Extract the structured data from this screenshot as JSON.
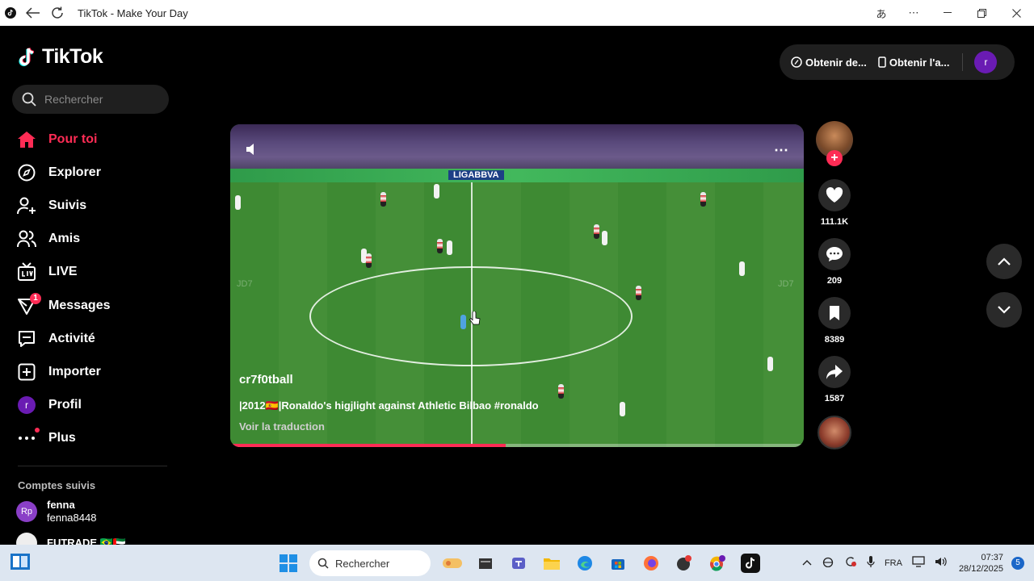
{
  "window": {
    "title": "TikTok - Make Your Day"
  },
  "app": {
    "logo_text": "TikTok",
    "search_placeholder": "Rechercher",
    "nav": [
      {
        "label": "Pour toi",
        "icon": "home-icon",
        "active": true
      },
      {
        "label": "Explorer",
        "icon": "compass-icon"
      },
      {
        "label": "Suivis",
        "icon": "user-follow-icon"
      },
      {
        "label": "Amis",
        "icon": "friends-icon"
      },
      {
        "label": "LIVE",
        "icon": "live-tv-icon"
      },
      {
        "label": "Messages",
        "icon": "messages-icon",
        "badge": "1"
      },
      {
        "label": "Activité",
        "icon": "activity-icon"
      },
      {
        "label": "Importer",
        "icon": "upload-plus-icon"
      },
      {
        "label": "Profil",
        "icon": "profile-avatar",
        "avatar_letter": "r"
      },
      {
        "label": "Plus",
        "icon": "more-dots-icon"
      }
    ],
    "followed_title": "Comptes suivis",
    "followed": [
      {
        "avatar": "Rp",
        "name": "fenna",
        "handle": "fenna8448"
      },
      {
        "name": "FUTRADE 🇧🇷🇦🇪"
      }
    ],
    "topbar": {
      "coins_label": "Obtenir de...",
      "app_label": "Obtenir l'a...",
      "user_letter": "r"
    }
  },
  "video": {
    "username": "cr7f0tball",
    "description": "|2012🇪🇸|Ronaldo's higjlight against Athletic Bilbao #ronaldo",
    "translate": "Voir la traduction",
    "watermark": "JD7",
    "banner": "LIGABBVA",
    "progress": 0.48
  },
  "actions": {
    "likes": "111.1K",
    "comments": "209",
    "bookmarks": "8389",
    "shares": "1587"
  },
  "taskbar": {
    "search_label": "Rechercher",
    "lang": "FRA",
    "time": "07:37",
    "date": "28/12/2025",
    "notifications": "5"
  },
  "colors": {
    "accent": "#fe2c55",
    "background": "#000000",
    "taskbar": "#dde6f1"
  }
}
